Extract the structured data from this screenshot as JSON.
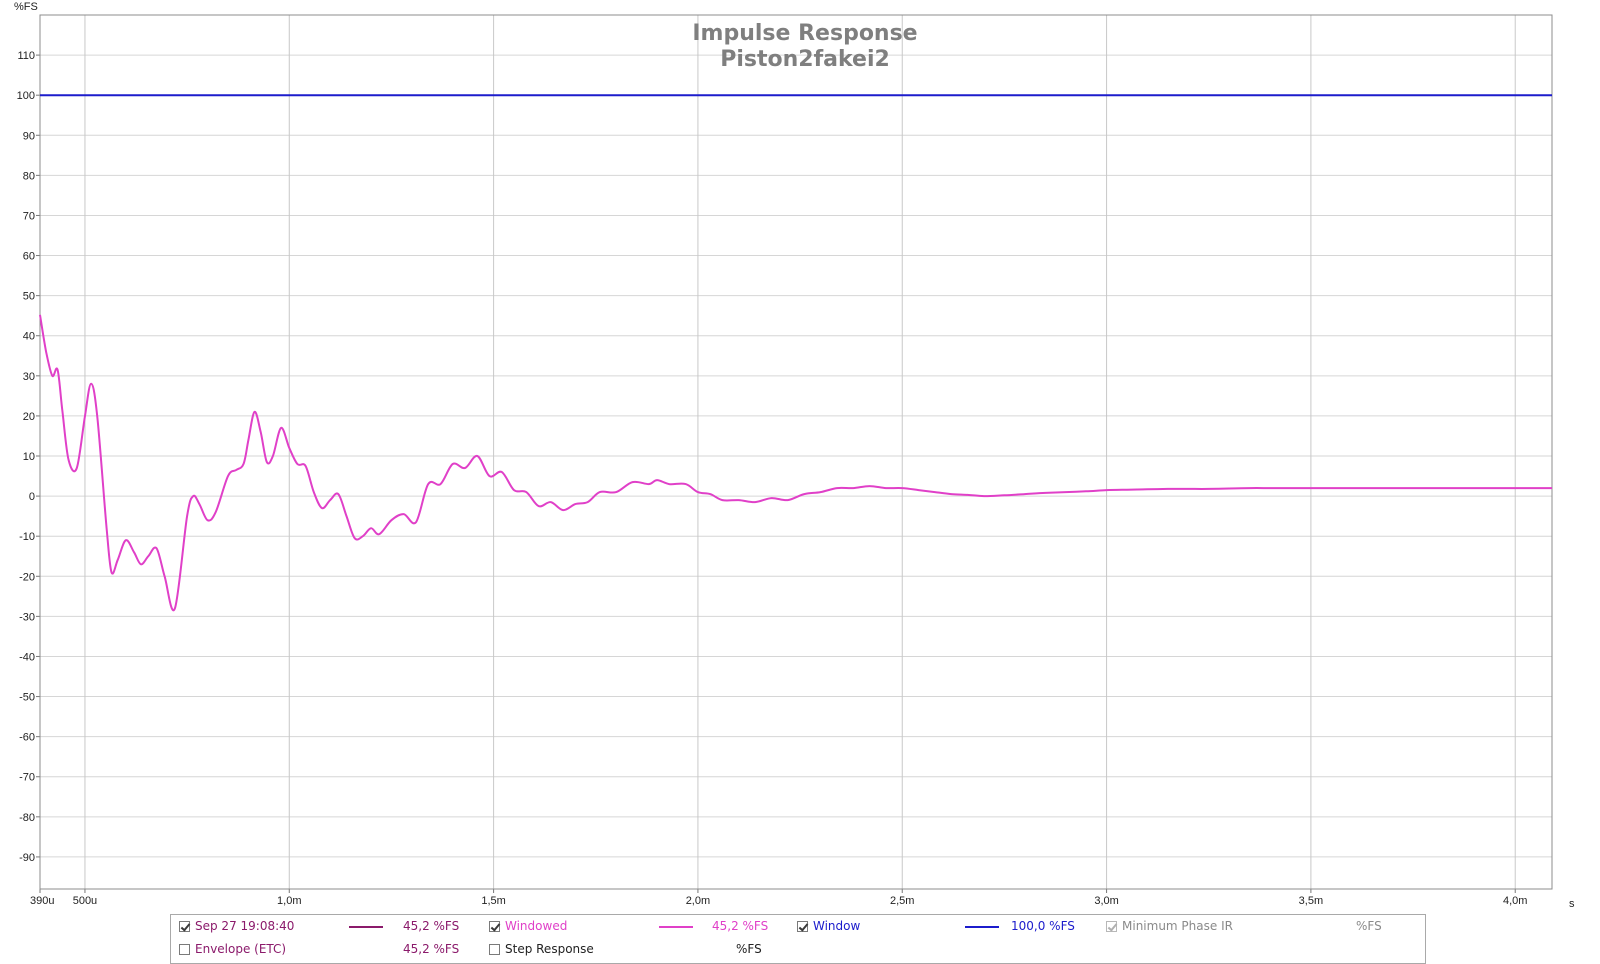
{
  "chart_data": {
    "type": "line",
    "title": "Impulse Response",
    "subtitle": "Piston2fakei2",
    "ylabel": "%FS",
    "xlabel": "s",
    "xlim": [
      0.00039,
      0.00409
    ],
    "ylim": [
      -98,
      120
    ],
    "grid": true,
    "x_ticks": [
      {
        "value": 0.00039,
        "label": "390u"
      },
      {
        "value": 0.0005,
        "label": "500u"
      },
      {
        "value": 0.001,
        "label": "1,0m"
      },
      {
        "value": 0.0015,
        "label": "1,5m"
      },
      {
        "value": 0.002,
        "label": "2,0m"
      },
      {
        "value": 0.0025,
        "label": "2,5m"
      },
      {
        "value": 0.003,
        "label": "3,0m"
      },
      {
        "value": 0.0035,
        "label": "3,5m"
      },
      {
        "value": 0.004,
        "label": "4,0m"
      }
    ],
    "y_ticks": [
      110,
      100,
      90,
      80,
      70,
      60,
      50,
      40,
      30,
      20,
      10,
      0,
      -10,
      -20,
      -30,
      -40,
      -50,
      -60,
      -70,
      -80,
      -90
    ],
    "series": [
      {
        "name": "Window",
        "color": "#1c1ccc",
        "x": [
          0.00039,
          0.00409
        ],
        "y": [
          100,
          100
        ]
      },
      {
        "name": "Windowed",
        "color": "#e040c8",
        "x": [
          0.00039,
          0.000405,
          0.00042,
          0.000433,
          0.000445,
          0.00046,
          0.00048,
          0.0005,
          0.000515,
          0.00053,
          0.000553,
          0.000565,
          0.00058,
          0.0006,
          0.00062,
          0.000637,
          0.000655,
          0.000675,
          0.000695,
          0.00072,
          0.00075,
          0.000765,
          0.00078,
          0.0008,
          0.00082,
          0.00085,
          0.00087,
          0.000888,
          0.0009,
          0.000915,
          0.00093,
          0.000945,
          0.00096,
          0.00098,
          0.001,
          0.00102,
          0.00104,
          0.00106,
          0.00108,
          0.0011,
          0.00112,
          0.00114,
          0.00116,
          0.00118,
          0.0012,
          0.00122,
          0.00125,
          0.00128,
          0.00131,
          0.00134,
          0.00137,
          0.0014,
          0.00143,
          0.00146,
          0.00149,
          0.00152,
          0.00155,
          0.00158,
          0.00161,
          0.00164,
          0.00167,
          0.0017,
          0.00173,
          0.00176,
          0.0018,
          0.00184,
          0.00188,
          0.0019,
          0.00193,
          0.00197,
          0.002,
          0.00203,
          0.00206,
          0.0021,
          0.00214,
          0.00218,
          0.00222,
          0.00226,
          0.0023,
          0.00234,
          0.00238,
          0.00242,
          0.00246,
          0.0025,
          0.00254,
          0.00258,
          0.00262,
          0.00266,
          0.0027,
          0.00275,
          0.0028,
          0.00285,
          0.0029,
          0.00295,
          0.003,
          0.00305,
          0.0031,
          0.00315,
          0.0032,
          0.00325,
          0.0033,
          0.00335,
          0.0034,
          0.00345,
          0.0035,
          0.00355,
          0.0036,
          0.00365,
          0.0037,
          0.00375,
          0.0038,
          0.00385,
          0.0039,
          0.00395,
          0.004,
          0.00409
        ],
        "y": [
          45.2,
          36,
          30,
          31.5,
          21,
          9,
          7,
          20,
          28,
          20,
          -8,
          -19,
          -16,
          -11,
          -14,
          -17,
          -15,
          -13,
          -20,
          -28,
          -5,
          0,
          -2,
          -6,
          -4,
          5,
          6.5,
          8,
          14,
          21,
          16,
          8.5,
          10,
          17,
          12,
          8,
          7.5,
          1,
          -3,
          -1,
          0.5,
          -5,
          -10.5,
          -10,
          -8,
          -9.5,
          -6,
          -4.5,
          -6.5,
          3,
          3,
          8,
          7,
          10,
          5,
          6,
          1.5,
          1,
          -2.5,
          -1.5,
          -3.5,
          -2,
          -1.5,
          1,
          1,
          3.5,
          3,
          4,
          3,
          3,
          1,
          0.5,
          -1,
          -1,
          -1.5,
          -0.5,
          -1,
          0.5,
          1,
          2,
          2,
          2.5,
          2,
          2,
          1.5,
          1,
          0.5,
          0.3,
          0,
          0.2,
          0.5,
          0.8,
          1,
          1.2,
          1.5,
          1.6,
          1.7,
          1.8,
          1.8,
          1.8,
          1.9,
          2,
          2,
          2,
          2,
          2,
          2,
          2,
          2,
          2,
          2,
          2,
          2,
          2,
          2,
          2
        ]
      }
    ]
  },
  "legend": {
    "row1": [
      {
        "label": "Sep 27 19:08:40",
        "value": "45,2 %FS",
        "checked": true,
        "color": "#8b1a6b",
        "swatch": true
      },
      {
        "label": "Windowed",
        "value": "45,2 %FS",
        "checked": true,
        "color": "#e040c8",
        "swatch": true
      },
      {
        "label": "Window",
        "value": "100,0 %FS",
        "checked": true,
        "color": "#1c1ccc",
        "swatch": true
      },
      {
        "label": "Minimum Phase IR",
        "value": "%FS",
        "checked": true,
        "color": "#8a8a8a",
        "swatch": false,
        "disabled": true
      }
    ],
    "row2": [
      {
        "label": "Envelope (ETC)",
        "value": "45,2 %FS",
        "checked": false,
        "color": "#8b1a6b"
      },
      {
        "label": "Step Response",
        "value": "%FS",
        "checked": false,
        "color": "#222222"
      }
    ]
  }
}
